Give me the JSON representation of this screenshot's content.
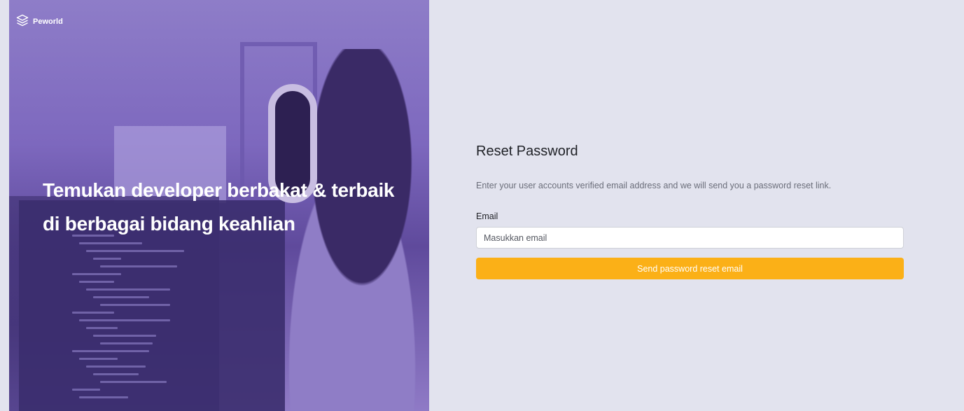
{
  "brand": {
    "name": "Peworld",
    "icon": "layers-icon"
  },
  "hero": {
    "headline": "Temukan developer berbakat & terbaik di berbagai bidang keahlian"
  },
  "form": {
    "title": "Reset Password",
    "description": "Enter your user accounts verified email address and we will send you a password reset link.",
    "email_label": "Email",
    "email_placeholder": "Masukkan email",
    "email_value": "",
    "submit_label": "Send password reset email"
  },
  "colors": {
    "background": "#e2e3ee",
    "hero_overlay": "#7d68be",
    "button": "#fbb017",
    "text_primary": "#1f2126",
    "text_secondary": "#6b6e7a"
  }
}
